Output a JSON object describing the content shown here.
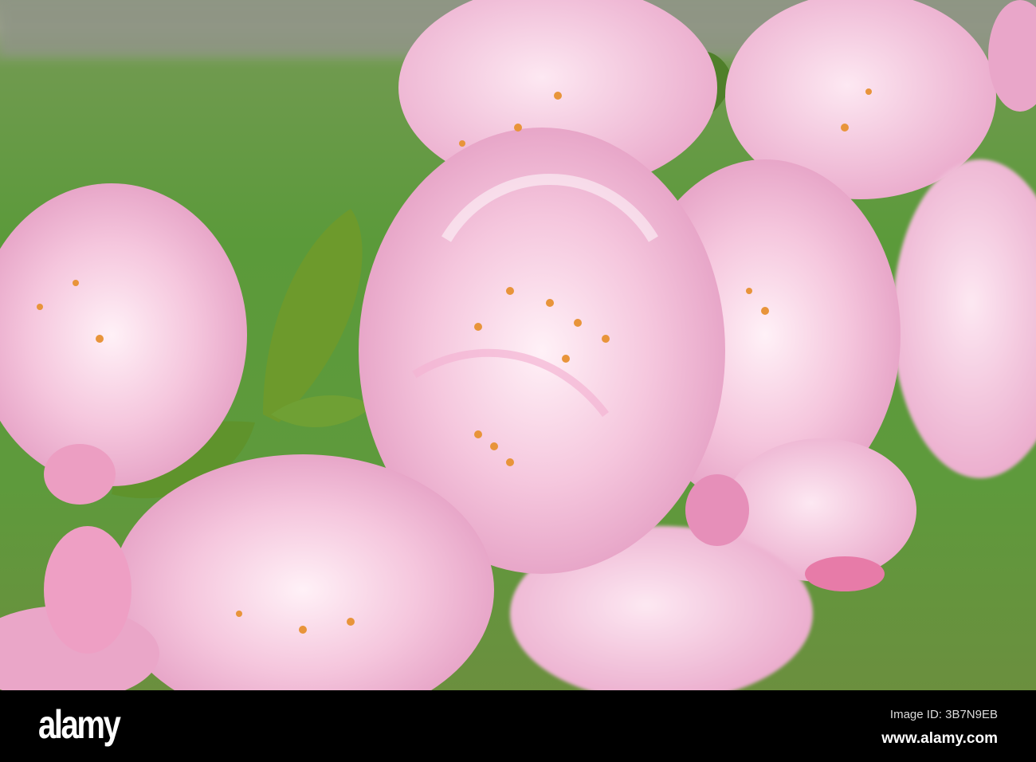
{
  "photo": {
    "subject": "pink flowers",
    "watermark": "alamy",
    "colors": {
      "petal": "#f2bcd8",
      "petal_light": "#fbe3ef",
      "leaf": "#5e8f2a",
      "background": "#5e9a3c",
      "stamen": "#e8943a"
    }
  },
  "footer": {
    "logo": "alamy",
    "image_id": "Image ID: 3B7N9EB",
    "url": "www.alamy.com"
  }
}
